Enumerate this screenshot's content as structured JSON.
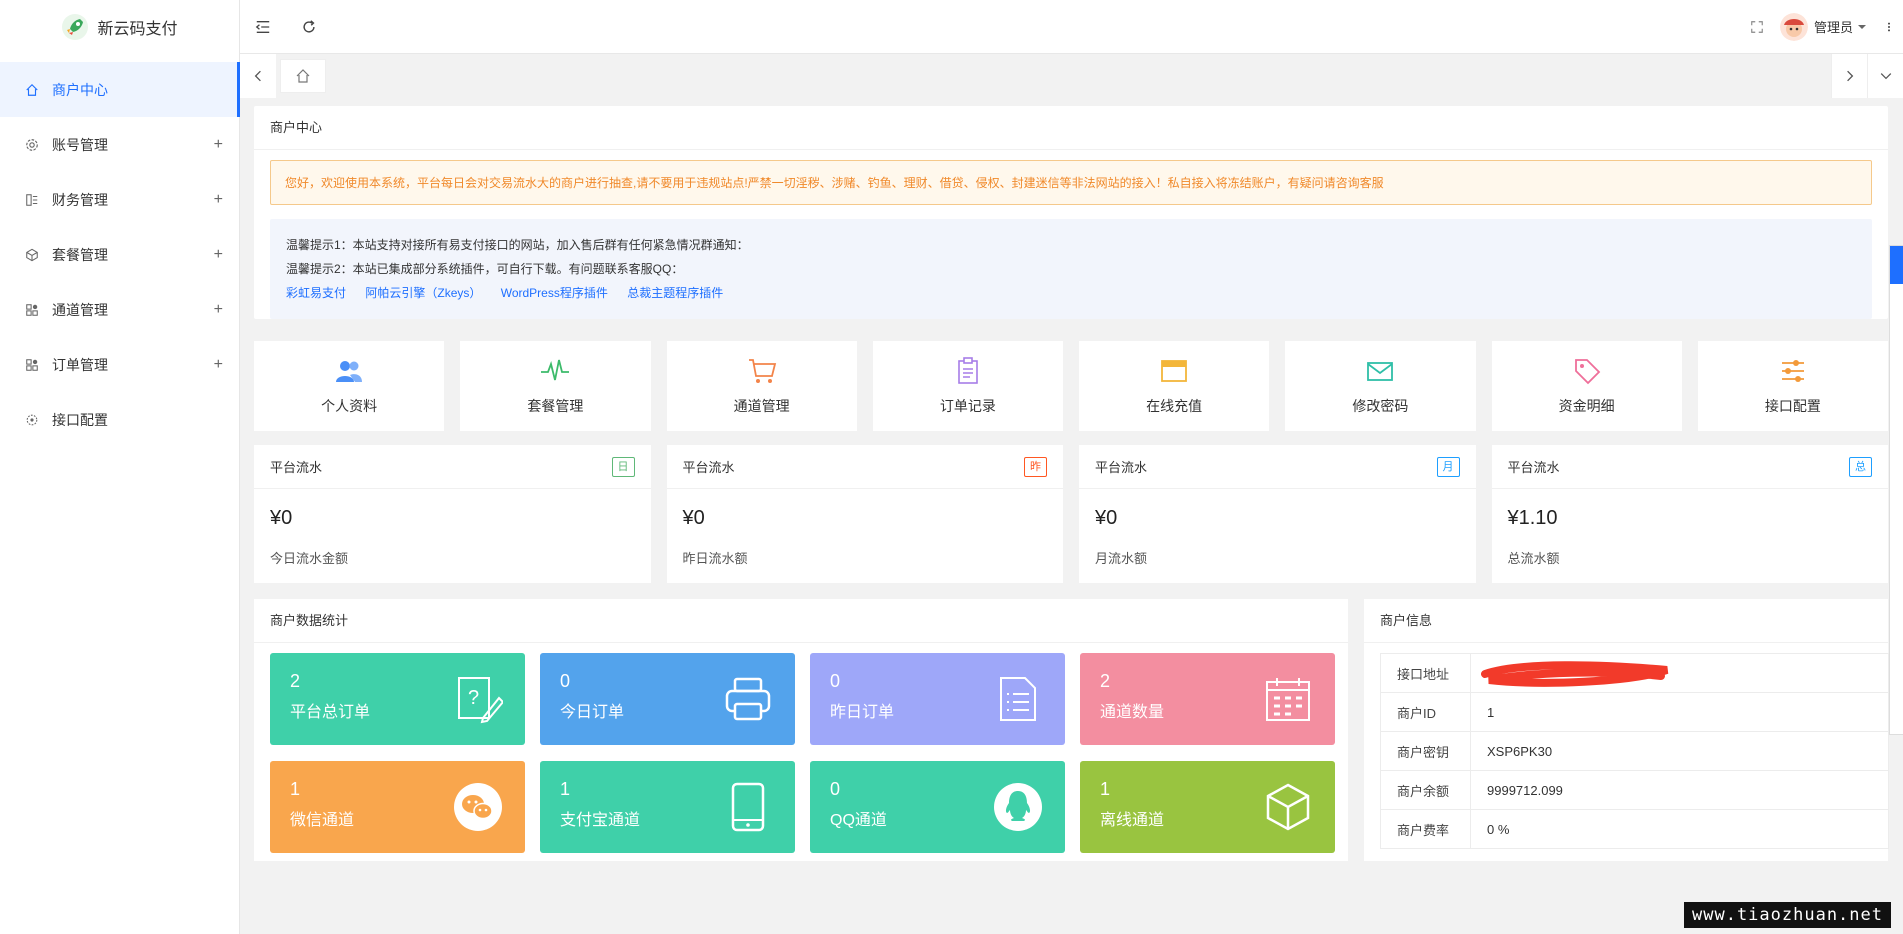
{
  "app": {
    "title": "新云码支付"
  },
  "sidebar": {
    "items": [
      {
        "label": "商户中心",
        "icon": "home-icon",
        "expandable": false,
        "active": true
      },
      {
        "label": "账号管理",
        "icon": "gear-icon",
        "expandable": true
      },
      {
        "label": "财务管理",
        "icon": "finance-icon",
        "expandable": true
      },
      {
        "label": "套餐管理",
        "icon": "cube-icon",
        "expandable": true
      },
      {
        "label": "通道管理",
        "icon": "grid-icon",
        "expandable": true
      },
      {
        "label": "订单管理",
        "icon": "grid-icon",
        "expandable": true
      },
      {
        "label": "接口配置",
        "icon": "api-icon",
        "expandable": false
      }
    ]
  },
  "header": {
    "user": "管理员"
  },
  "main": {
    "panel_title": "商户中心",
    "notice": "您好，欢迎使用本系统，平台每日会对交易流水大的商户进行抽查,请不要用于违规站点!严禁一切淫秽、涉赌、钓鱼、理财、借贷、侵权、封建迷信等非法网站的接入！私自接入将冻结账户，有疑问请咨询客服",
    "tip1": "温馨提示1：本站支持对接所有易支付接口的网站，加入售后群有任何紧急情况群通知：",
    "tip2": "温馨提示2：本站已集成部分系统插件，可自行下载。有问题联系客服QQ：",
    "links": [
      "彩虹易支付",
      "阿帕云引擎（Zkeys）",
      "WordPress程序插件",
      "总裁主题程序插件"
    ]
  },
  "shortcuts": [
    {
      "label": "个人资料",
      "icon": "users-icon",
      "color": "#4a8ff7"
    },
    {
      "label": "套餐管理",
      "icon": "pulse-icon",
      "color": "#3dbb6b"
    },
    {
      "label": "通道管理",
      "icon": "cart-icon",
      "color": "#f3844a"
    },
    {
      "label": "订单记录",
      "icon": "clipboard-icon",
      "color": "#a77de8"
    },
    {
      "label": "在线充值",
      "icon": "wallet-icon",
      "color": "#f3b63a"
    },
    {
      "label": "修改密码",
      "icon": "mail-icon",
      "color": "#2fbfa8"
    },
    {
      "label": "资金明细",
      "icon": "tag-icon",
      "color": "#ef6f9a"
    },
    {
      "label": "接口配置",
      "icon": "sliders-icon",
      "color": "#f39a3a"
    }
  ],
  "flows": [
    {
      "title": "平台流水",
      "badge": "日",
      "badge_color": "#5fb878",
      "value": "0",
      "desc": "今日流水金额"
    },
    {
      "title": "平台流水",
      "badge": "昨",
      "badge_color": "#ff5722",
      "value": "0",
      "desc": "昨日流水额"
    },
    {
      "title": "平台流水",
      "badge": "月",
      "badge_color": "#1e9fff",
      "value": "0",
      "desc": "月流水额"
    },
    {
      "title": "平台流水",
      "badge": "总",
      "badge_color": "#1e9fff",
      "value": "1.10",
      "desc": "总流水额"
    }
  ],
  "currency": "¥",
  "stats": {
    "title": "商户数据统计",
    "items": [
      {
        "value": "2",
        "label": "平台总订单",
        "color": "#3fd0a9",
        "icon": "edit-note-icon"
      },
      {
        "value": "0",
        "label": "今日订单",
        "color": "#53a3ec",
        "icon": "printer-icon"
      },
      {
        "value": "0",
        "label": "昨日订单",
        "color": "#9ea7f9",
        "icon": "document-list-icon"
      },
      {
        "value": "2",
        "label": "通道数量",
        "color": "#f38ea0",
        "icon": "calendar-icon"
      },
      {
        "value": "1",
        "label": "微信通道",
        "color": "#f9a64d",
        "icon": "wechat-icon"
      },
      {
        "value": "1",
        "label": "支付宝通道",
        "color": "#3fd0a9",
        "icon": "tablet-icon"
      },
      {
        "value": "0",
        "label": "QQ通道",
        "color": "#3fd0a9",
        "icon": "qq-icon"
      },
      {
        "value": "1",
        "label": "离线通道",
        "color": "#99c440",
        "icon": "box-icon"
      }
    ]
  },
  "merchant": {
    "title": "商户信息",
    "rows": [
      {
        "key": "接口地址",
        "value": ""
      },
      {
        "key": "商户ID",
        "value": "1"
      },
      {
        "key": "商户密钥",
        "value": "XSP6PK30"
      },
      {
        "key": "商户余额",
        "value": "9999712.099"
      },
      {
        "key": "商户费率",
        "value": "0 %"
      }
    ]
  },
  "watermark": "www.tiaozhuan.net"
}
